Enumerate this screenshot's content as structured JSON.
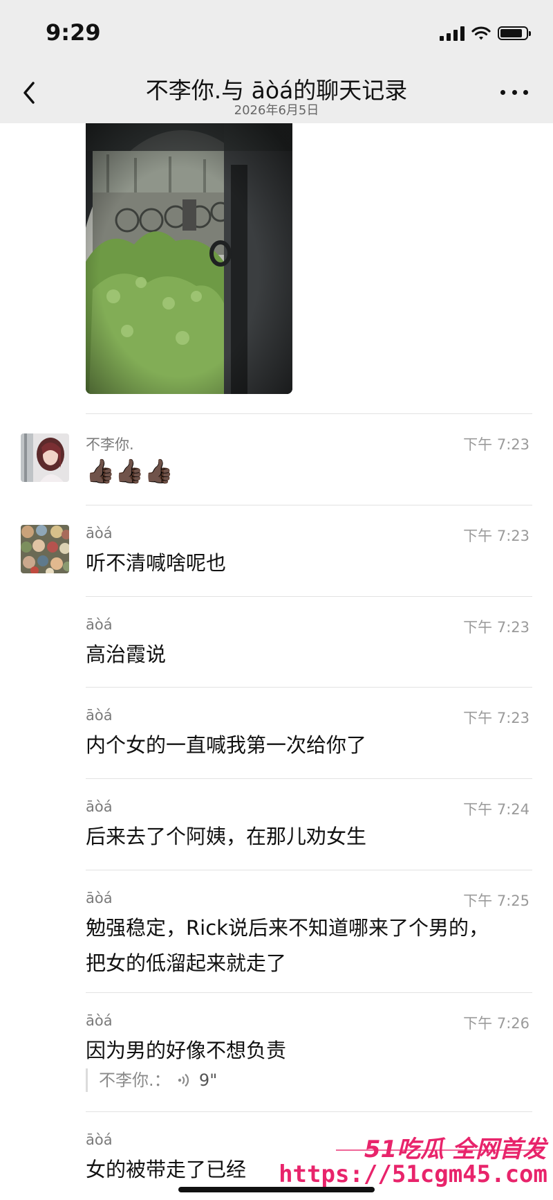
{
  "status_bar": {
    "time": "9:29",
    "battery_level": 0.85
  },
  "header": {
    "title": "不李你.与 āòá的聊天记录",
    "subtitle": "2026年6月5日"
  },
  "messages": [
    {
      "sender": "不李你.",
      "time": "下午 7:23",
      "text": "👍🏿👍🏿👍🏿"
    },
    {
      "sender": "āòá",
      "time": "下午 7:23",
      "text": "听不清喊啥呢也"
    },
    {
      "sender": "āòá",
      "time": "下午 7:23",
      "text": "高治霞说"
    },
    {
      "sender": "āòá",
      "time": "下午 7:23",
      "text": "内个女的一直喊我第一次给你了"
    },
    {
      "sender": "āòá",
      "time": "下午 7:24",
      "text": "后来去了个阿姨，在那儿劝女生"
    },
    {
      "sender": "āòá",
      "time": "下午 7:25",
      "text_line1": "勉强稳定，Rick说后来不知道哪来了个男的，",
      "text_line2": "把女的低溜起来就走了"
    },
    {
      "sender": "āòá",
      "time": "下午 7:26",
      "text": "因为男的好像不想负责",
      "quote": "不李你.：",
      "quote_duration": "9\""
    },
    {
      "sender": "āòá",
      "text": "女的被带走了已经"
    }
  ],
  "watermark": {
    "brand": "51吃瓜 全网首发",
    "url": "https://51cgm45.com"
  },
  "colors": {
    "nav_bg": "#ededed",
    "watermark": "#e8246b",
    "secondary_text": "#9a9a9a"
  }
}
